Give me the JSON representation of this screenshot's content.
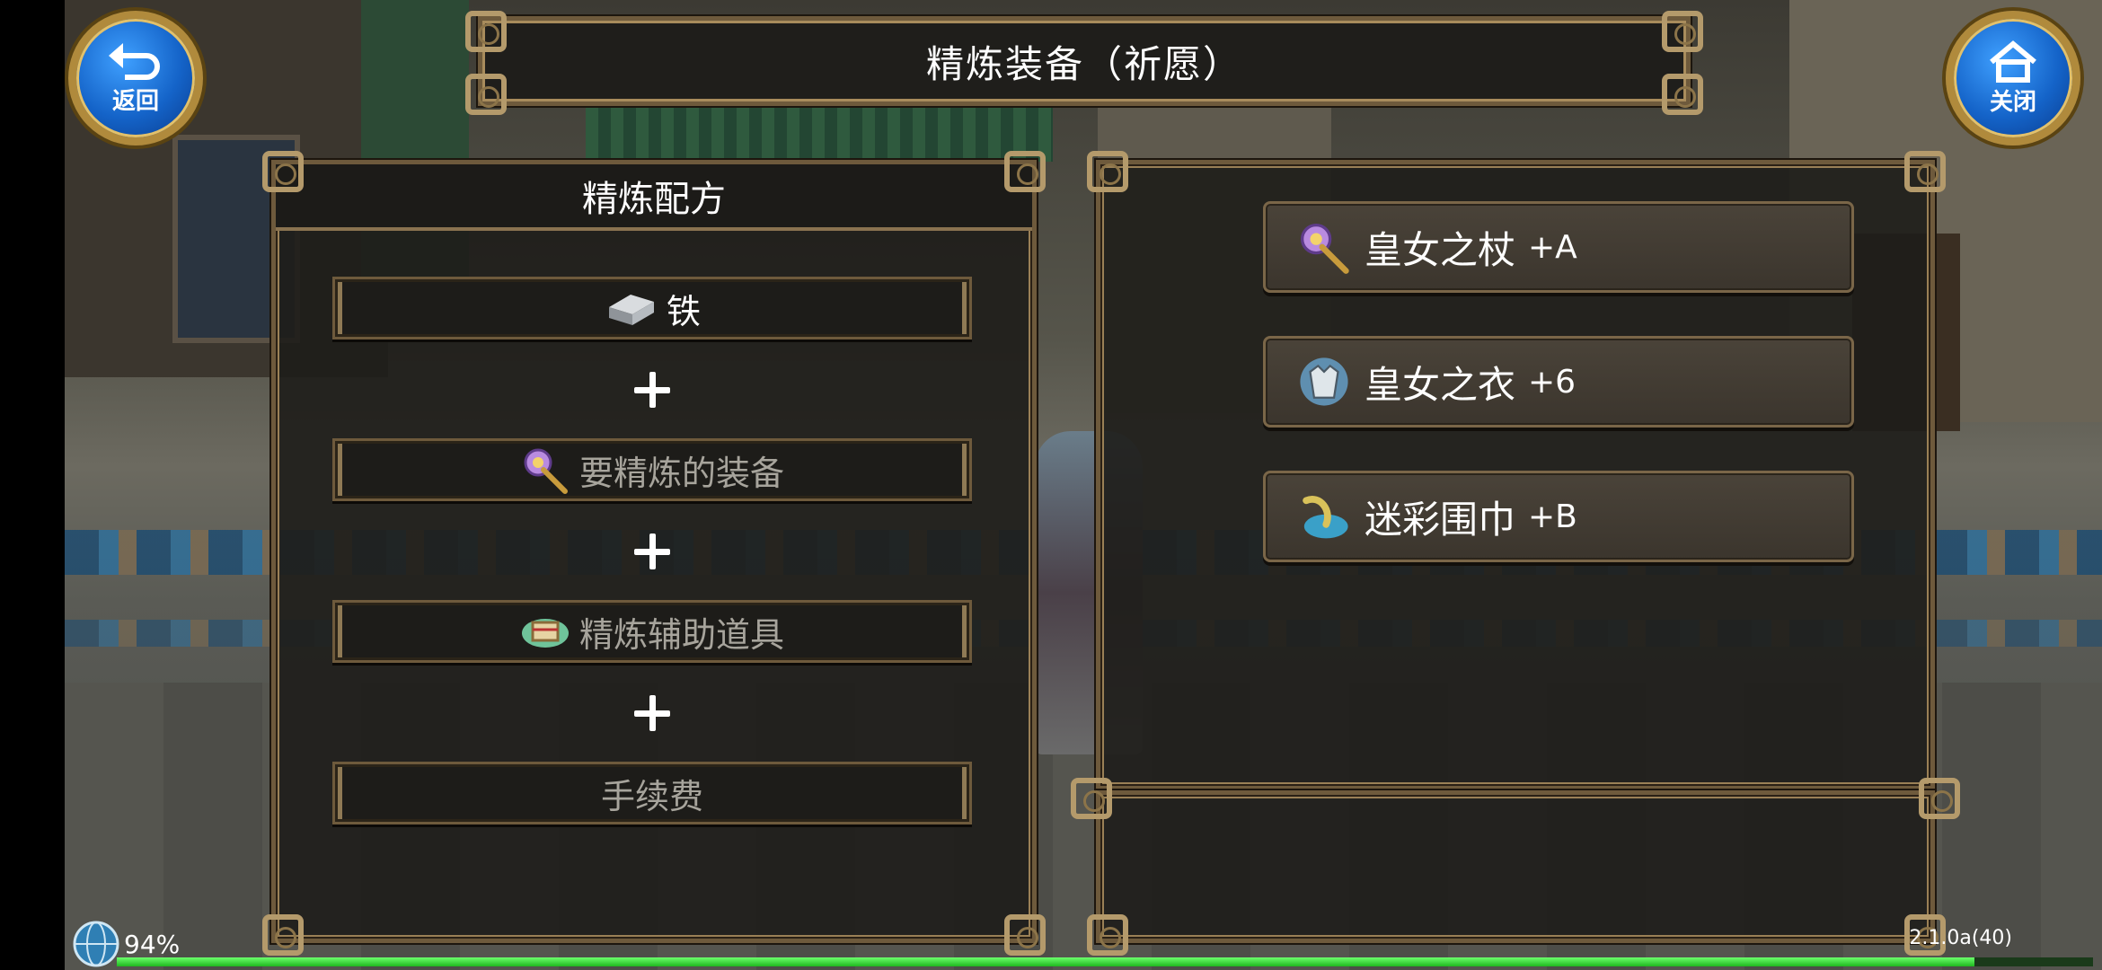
{
  "header": {
    "title": "精炼装备（祈愿）"
  },
  "buttons": {
    "back_label": "返回",
    "close_label": "关闭"
  },
  "recipe": {
    "title": "精炼配方",
    "slots": [
      {
        "label": "铁",
        "icon": "iron-ingot-icon"
      },
      {
        "label": "要精炼的装备",
        "icon": "staff-icon"
      },
      {
        "label": "精炼辅助道具",
        "icon": "refine-box-icon"
      },
      {
        "label": "手续费",
        "icon": ""
      }
    ]
  },
  "equipment": [
    {
      "name": "皇女之杖",
      "level": "+A",
      "icon": "staff-icon"
    },
    {
      "name": "皇女之衣",
      "level": "+6",
      "icon": "armor-icon"
    },
    {
      "name": "迷彩围巾",
      "level": "+B",
      "icon": "scarf-icon"
    }
  ],
  "status": {
    "battery": "94%",
    "battery_fraction": 0.94,
    "version": "2.1.0a(40)"
  },
  "colors": {
    "frame": "#6e5a3c",
    "frame_trim": "#b49a6b",
    "button_blue": "#1463c8",
    "progress_green": "#1fb81f"
  }
}
